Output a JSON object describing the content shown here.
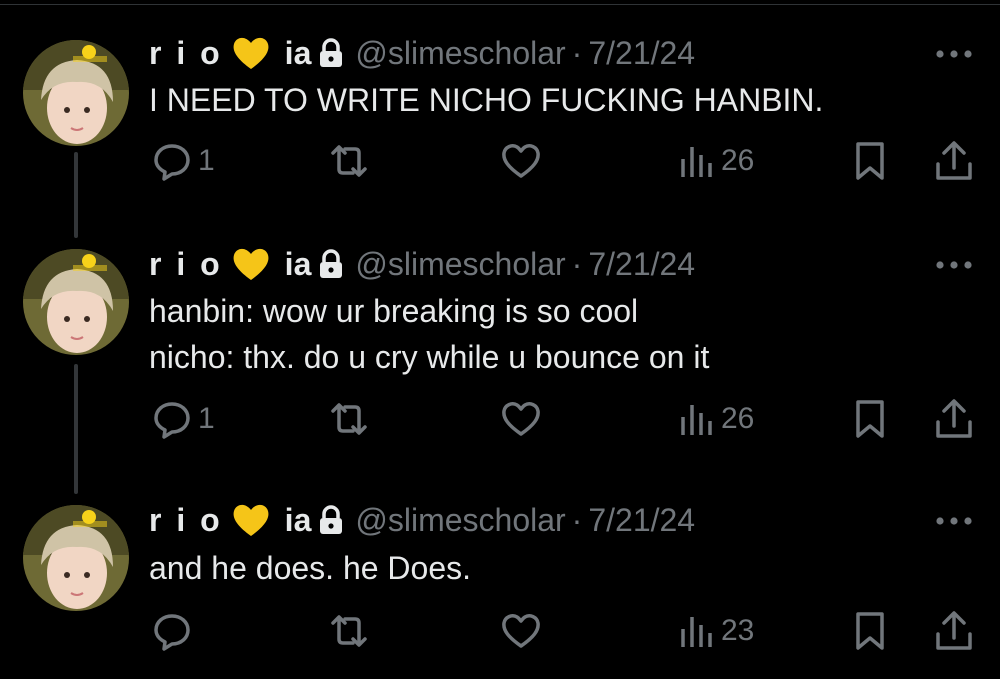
{
  "tweets": [
    {
      "display_name_part1": "r i o",
      "display_name_part2": "ia",
      "handle": "@slimescholar",
      "separator": "·",
      "date": "7/21/24",
      "body_lines": [
        "I NEED TO WRITE NICHO FUCKING HANBIN."
      ],
      "reply_count": "1",
      "retweet_count": "",
      "like_count": "",
      "view_count": "26"
    },
    {
      "display_name_part1": "r i o",
      "display_name_part2": "ia",
      "handle": "@slimescholar",
      "separator": "·",
      "date": "7/21/24",
      "body_lines": [
        "hanbin: wow ur breaking is so cool",
        "nicho: thx. do u cry while u bounce on it"
      ],
      "reply_count": "1",
      "retweet_count": "",
      "like_count": "",
      "view_count": "26"
    },
    {
      "display_name_part1": "r i o",
      "display_name_part2": "ia",
      "handle": "@slimescholar",
      "separator": "·",
      "date": "7/21/24",
      "body_lines": [
        "and he does. he Does."
      ],
      "reply_count": "",
      "retweet_count": "",
      "like_count": "",
      "view_count": "23"
    }
  ],
  "icons": {
    "badge": "yellow-heart-icon",
    "protected": "lock-icon",
    "more": "more-icon",
    "reply": "reply-icon",
    "retweet": "retweet-icon",
    "like": "like-icon",
    "views": "views-icon",
    "bookmark": "bookmark-icon",
    "share": "share-icon"
  },
  "colors": {
    "background": "#000000",
    "text_primary": "#e7e9ea",
    "text_secondary": "#71767b",
    "thread_line": "#333639",
    "heart": "#f5c518"
  }
}
